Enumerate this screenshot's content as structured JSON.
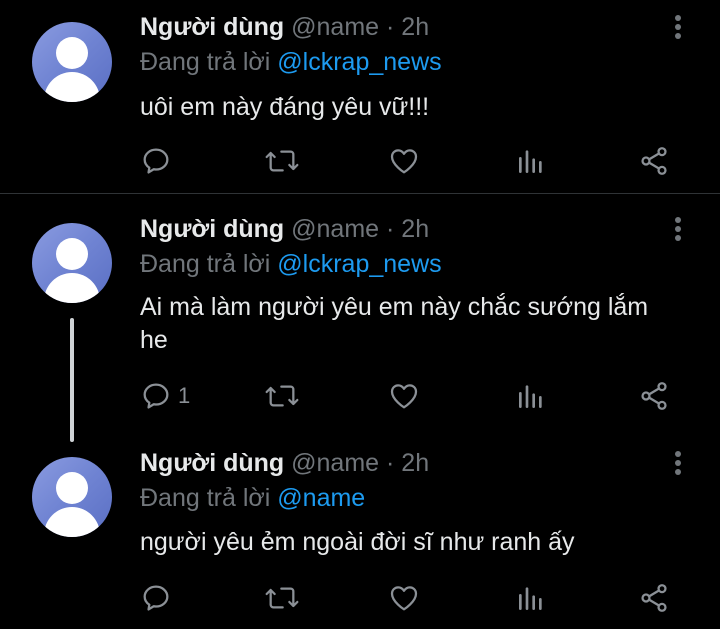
{
  "tweets": [
    {
      "name": "Người dùng",
      "handle": "@name",
      "separator": "·",
      "time": "2h",
      "reply_prefix": "Đang trả lời",
      "reply_to": "@lckrap_news",
      "text": "uôi em này đáng yêu vữ!!!",
      "reply_count": "",
      "avatar_icon": "default-user-avatar"
    },
    {
      "name": "Người dùng",
      "handle": "@name",
      "separator": "·",
      "time": "2h",
      "reply_prefix": "Đang trả lời",
      "reply_to": "@lckrap_news",
      "text": "Ai mà làm người yêu em này chắc sướng lắm he",
      "reply_count": "1",
      "avatar_icon": "default-user-avatar"
    },
    {
      "name": "Người dùng",
      "handle": "@name",
      "separator": "·",
      "time": "2h",
      "reply_prefix": "Đang trả lời",
      "reply_to": "@name",
      "text": "người yêu ẻm ngoài đời sĩ như ranh ấy",
      "reply_count": "",
      "avatar_icon": "default-user-avatar"
    }
  ],
  "icons": [
    "reply-icon",
    "retweet-icon",
    "like-icon",
    "analytics-icon",
    "share-icon",
    "more-options-icon"
  ],
  "colors": {
    "background": "#000000",
    "text": "#e7e9ea",
    "muted": "#71767b",
    "link": "#1d9bf0"
  }
}
